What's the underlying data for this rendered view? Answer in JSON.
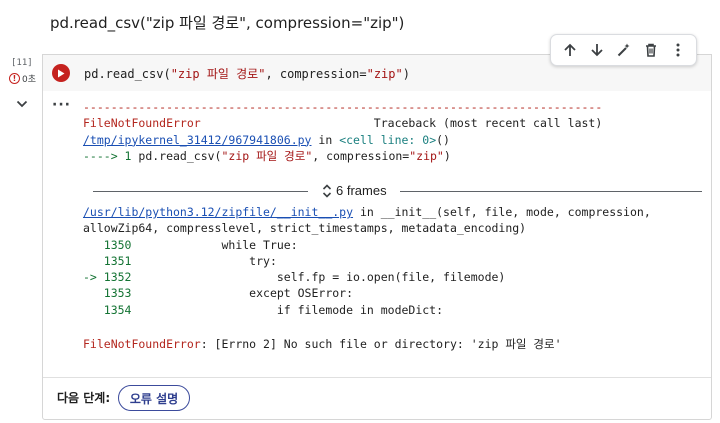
{
  "markdown": {
    "text": "pd.read_csv(\"zip 파일 경로\", compression=\"zip\")"
  },
  "gutter": {
    "exec_count": "[11]",
    "exec_icon": "error-circle-icon",
    "exec_time": "0초"
  },
  "cell": {
    "code": {
      "fn": "pd.read_csv(",
      "arg1": "\"zip 파일 경로\"",
      "mid": ", compression=",
      "arg2": "\"zip\"",
      "end": ")"
    }
  },
  "toolbar": {
    "items": [
      {
        "icon": "arrow-up-icon"
      },
      {
        "icon": "arrow-down-icon"
      },
      {
        "icon": "edit-wand-icon"
      },
      {
        "icon": "delete-icon"
      },
      {
        "icon": "more-vert-icon"
      }
    ]
  },
  "output": {
    "dashes": "---------------------------------------------------------------------------",
    "exc_name": "FileNotFoundError",
    "traceback_label": "Traceback (most recent call last)",
    "file1": "/tmp/ipykernel_31412/967941806.py",
    "in_word": " in ",
    "cell_line": "<cell line: 0>",
    "parens": "()",
    "arrow_line_prefix": "----> 1 ",
    "arrow_code_fn": "pd.read_csv(",
    "arrow_code_arg1": "\"zip 파일 경로\"",
    "arrow_code_mid": ", compression=",
    "arrow_code_arg2": "\"zip\"",
    "arrow_code_end": ")",
    "frames_label": "6 frames",
    "file2": "/usr/lib/python3.12/zipfile/__init__.py",
    "in_word2": " in ",
    "func_sig1": "__init__(self, file, mode, compression,",
    "func_sig2": "allowZip64, compresslevel, strict_timestamps, metadata_encoding)",
    "lines": [
      {
        "prefix": "   1350 ",
        "code": "            while True:"
      },
      {
        "prefix": "   1351 ",
        "code": "                try:"
      },
      {
        "prefix": "-> 1352 ",
        "code": "                    self.fp = io.open(file, filemode)"
      },
      {
        "prefix": "   1353 ",
        "code": "                except OSError:"
      },
      {
        "prefix": "   1354 ",
        "code": "                    if filemode in modeDict:"
      }
    ],
    "error_name": "FileNotFoundError",
    "error_msg": ": [Errno 2] No such file or directory: 'zip 파일 경로'"
  },
  "footer": {
    "next_steps_label": "다음 단계:",
    "explain_button": "오류 설명"
  },
  "colors": {
    "error_red": "#c5221f",
    "link_blue": "#1a4fb3",
    "button_border": "#3c4b9c"
  }
}
